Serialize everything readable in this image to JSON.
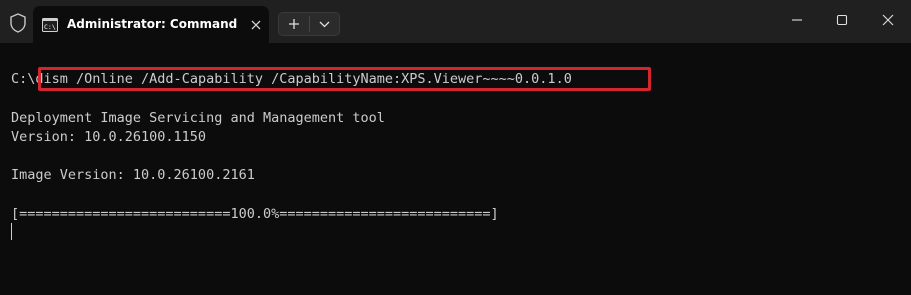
{
  "window": {
    "tab_title": "Administrator: Command Pro",
    "tab_icon": "cmd-icon",
    "shield_icon": "shield-icon",
    "new_tab_icon": "plus-icon",
    "dropdown_icon": "chevron-down-icon",
    "controls": [
      "minimize-icon",
      "maximize-icon",
      "close-icon"
    ]
  },
  "terminal": {
    "prompt": "C:\\",
    "command": "dism /Online /Add-Capability /CapabilityName:XPS.Viewer~~~~0.0.1.0",
    "output_line1": "Deployment Image Servicing and Management tool",
    "output_line2": "Version: 10.0.26100.1150",
    "output_line3": "Image Version: 10.0.26100.2161",
    "progress": 100.0,
    "progress_text": "[==========================100.0%==========================]"
  },
  "colors": {
    "terminal_bg": "#0c0c0c",
    "titlebar_bg": "#202020",
    "text": "#cccccc",
    "highlight": "#d4262f"
  }
}
